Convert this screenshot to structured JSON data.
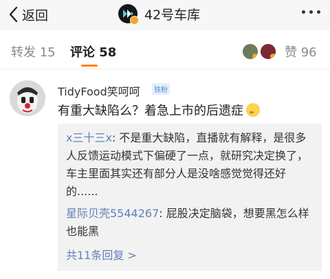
{
  "header": {
    "back_label": "返回",
    "title": "42号车库",
    "logo": "42-garage-logo",
    "verified_badge": "verified-badge"
  },
  "tabs": {
    "repost": "转发 15",
    "comment": "评论 58",
    "like": "赞 96",
    "active_color": "#ff8200"
  },
  "comment": {
    "user": "TidyFood笑呵呵",
    "badge": "铁粉",
    "text": "有重大缺陷么？着急上市的后遗症",
    "emoji": "shushing-face-emoji",
    "replies": [
      {
        "user": "x三十三x",
        "text": ": 不是重大缺陷，直播就有解释，是很多人反馈运动模式下偏硬了一点，就研究决定换了，车主里面其实还有部分人是没啥感觉觉得还好的......"
      },
      {
        "user": "星际贝壳5544267",
        "text": ": 屁股决定脑袋，想要黑怎么样也能黑"
      }
    ],
    "view_all": "共11条回复 >"
  },
  "colors": {
    "link_blue": "#5f81b8",
    "badge_blue": "#5a8fd6"
  }
}
